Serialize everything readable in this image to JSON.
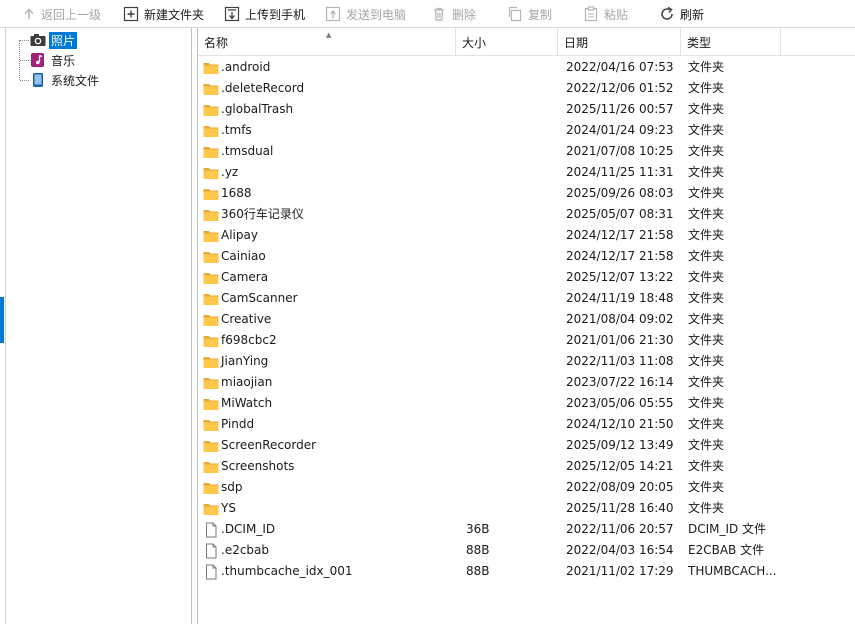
{
  "toolbar": {
    "back": "返回上一级",
    "new_folder": "新建文件夹",
    "upload": "上传到手机",
    "send": "发送到电脑",
    "delete": "删除",
    "copy": "复制",
    "paste": "粘贴",
    "refresh": "刷新"
  },
  "tree": {
    "items": [
      {
        "label": "照片",
        "icon": "camera-icon"
      },
      {
        "label": "音乐",
        "icon": "music-icon"
      },
      {
        "label": "系统文件",
        "icon": "phone-icon"
      }
    ]
  },
  "columns": {
    "name": "名称",
    "size": "大小",
    "date": "日期",
    "type": "类型"
  },
  "files": [
    {
      "name": ".android",
      "size": "",
      "date": "2022/04/16 07:53",
      "type": "文件夹",
      "kind": "folder"
    },
    {
      "name": ".deleteRecord",
      "size": "",
      "date": "2022/12/06 01:52",
      "type": "文件夹",
      "kind": "folder"
    },
    {
      "name": ".globalTrash",
      "size": "",
      "date": "2025/11/26 00:57",
      "type": "文件夹",
      "kind": "folder"
    },
    {
      "name": ".tmfs",
      "size": "",
      "date": "2024/01/24 09:23",
      "type": "文件夹",
      "kind": "folder"
    },
    {
      "name": ".tmsdual",
      "size": "",
      "date": "2021/07/08 10:25",
      "type": "文件夹",
      "kind": "folder"
    },
    {
      "name": ".yz",
      "size": "",
      "date": "2024/11/25 11:31",
      "type": "文件夹",
      "kind": "folder"
    },
    {
      "name": "1688",
      "size": "",
      "date": "2025/09/26 08:03",
      "type": "文件夹",
      "kind": "folder"
    },
    {
      "name": "360行车记录仪",
      "size": "",
      "date": "2025/05/07 08:31",
      "type": "文件夹",
      "kind": "folder"
    },
    {
      "name": "Alipay",
      "size": "",
      "date": "2024/12/17 21:58",
      "type": "文件夹",
      "kind": "folder"
    },
    {
      "name": "Cainiao",
      "size": "",
      "date": "2024/12/17 21:58",
      "type": "文件夹",
      "kind": "folder"
    },
    {
      "name": "Camera",
      "size": "",
      "date": "2025/12/07 13:22",
      "type": "文件夹",
      "kind": "folder"
    },
    {
      "name": "CamScanner",
      "size": "",
      "date": "2024/11/19 18:48",
      "type": "文件夹",
      "kind": "folder"
    },
    {
      "name": "Creative",
      "size": "",
      "date": "2021/08/04 09:02",
      "type": "文件夹",
      "kind": "folder"
    },
    {
      "name": "f698cbc2",
      "size": "",
      "date": "2021/01/06 21:30",
      "type": "文件夹",
      "kind": "folder"
    },
    {
      "name": "JianYing",
      "size": "",
      "date": "2022/11/03 11:08",
      "type": "文件夹",
      "kind": "folder"
    },
    {
      "name": "miaojian",
      "size": "",
      "date": "2023/07/22 16:14",
      "type": "文件夹",
      "kind": "folder"
    },
    {
      "name": "MiWatch",
      "size": "",
      "date": "2023/05/06 05:55",
      "type": "文件夹",
      "kind": "folder"
    },
    {
      "name": "Pindd",
      "size": "",
      "date": "2024/12/10 21:50",
      "type": "文件夹",
      "kind": "folder"
    },
    {
      "name": "ScreenRecorder",
      "size": "",
      "date": "2025/09/12 13:49",
      "type": "文件夹",
      "kind": "folder"
    },
    {
      "name": "Screenshots",
      "size": "",
      "date": "2025/12/05 14:21",
      "type": "文件夹",
      "kind": "folder"
    },
    {
      "name": "sdp",
      "size": "",
      "date": "2022/08/09 20:05",
      "type": "文件夹",
      "kind": "folder"
    },
    {
      "name": "YS",
      "size": "",
      "date": "2025/11/28 16:40",
      "type": "文件夹",
      "kind": "folder"
    },
    {
      "name": ".DCIM_ID",
      "size": "36B",
      "date": "2022/11/06 20:57",
      "type": "DCIM_ID 文件",
      "kind": "file"
    },
    {
      "name": ".e2cbab",
      "size": "88B",
      "date": "2022/04/03 16:54",
      "type": "E2CBAB 文件",
      "kind": "file"
    },
    {
      "name": ".thumbcache_idx_001",
      "size": "88B",
      "date": "2021/11/02 17:29",
      "type": "THUMBCACH...",
      "kind": "file"
    }
  ]
}
